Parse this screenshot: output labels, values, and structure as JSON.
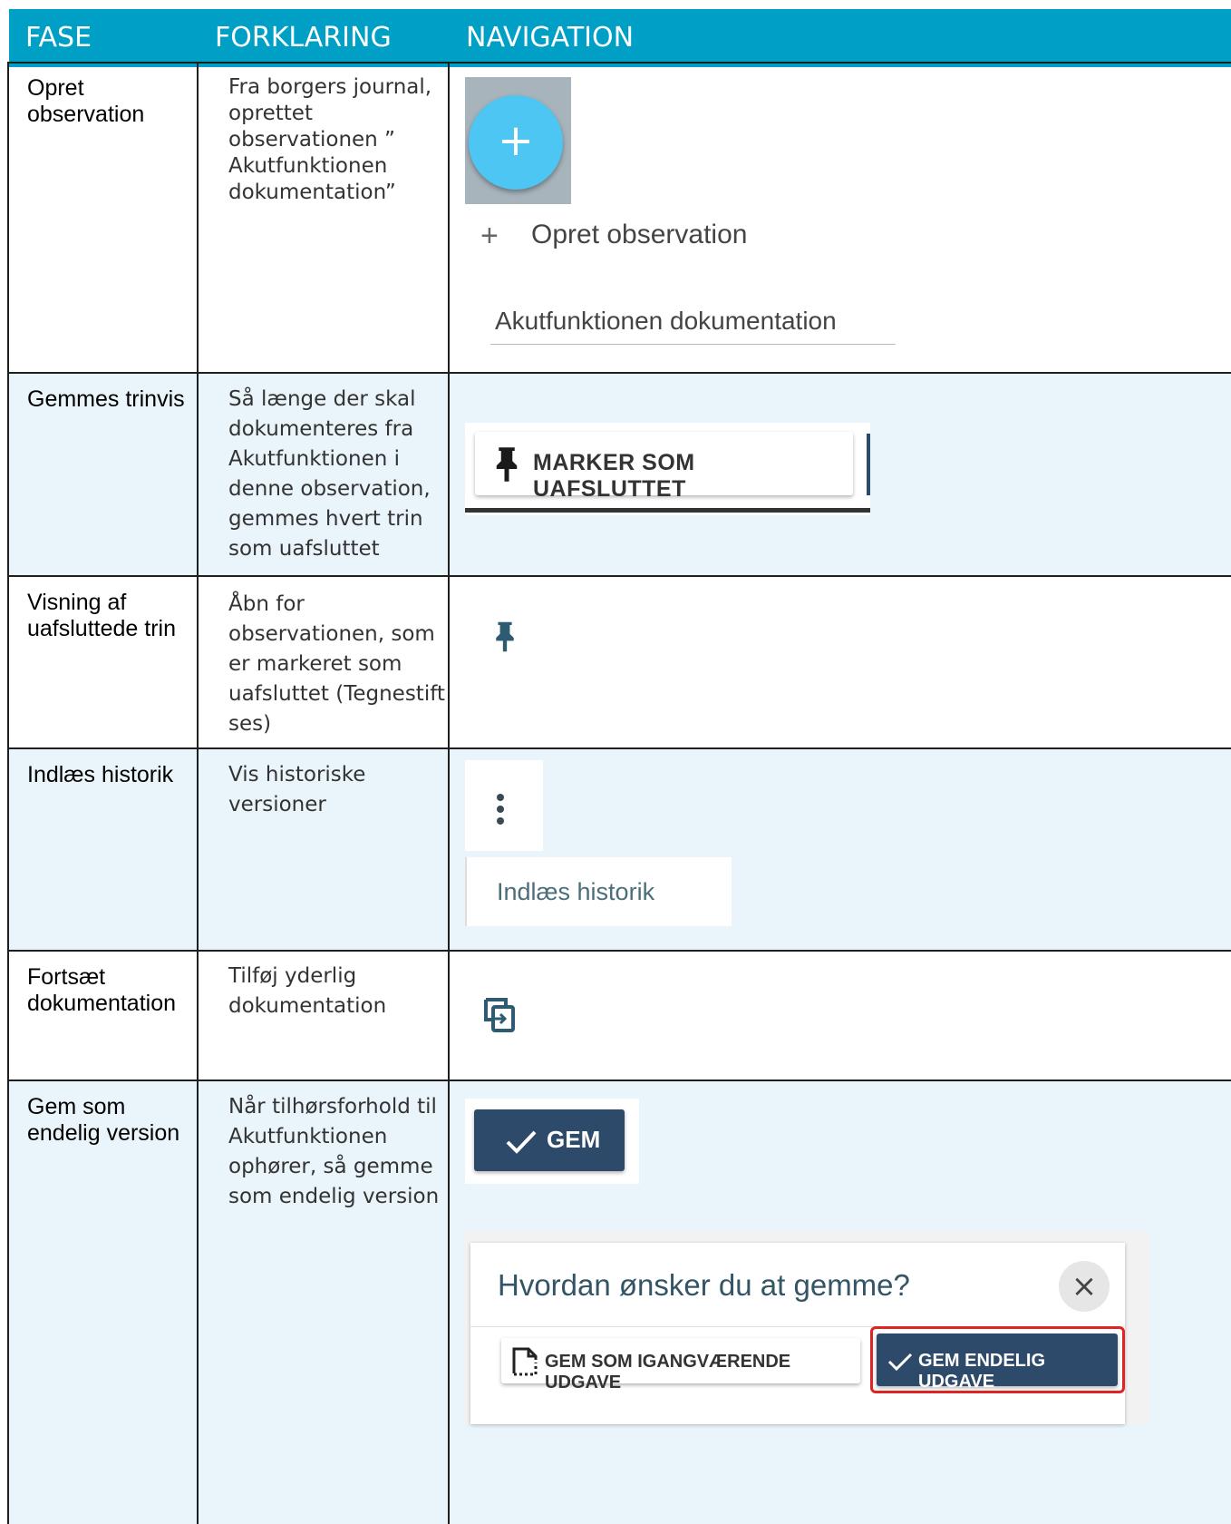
{
  "header": {
    "col1": "FASE",
    "col2": "FORKLARING",
    "col3": "NAVIGATION"
  },
  "colors": {
    "header_bg": "#00a0c6",
    "row_tint": "#eaf4fb",
    "primary_button": "#2e4a6b",
    "fab": "#4dc6f4",
    "highlight_border": "#e02424"
  },
  "rows": [
    {
      "fase": "Opret observation",
      "forklaring": "Fra borgers journal, oprettet observationen ” Akutfunktionen dokumentation”",
      "nav": {
        "fab_icon": "plus-icon",
        "fab_symbol": "+",
        "menu_symbol": "+",
        "menu_item": "Opret observation",
        "template_value": "Akutfunktionen dokumentation"
      }
    },
    {
      "fase": "Gemmes trinvis",
      "forklaring": "Så længe der skal dokumenteres fra Akutfunktionen i denne observation, gemmes hvert trin som uafsluttet",
      "nav": {
        "button_icon": "pin-icon",
        "button_label": "MARKER SOM UAFSLUTTET"
      }
    },
    {
      "fase": "Visning af uafsluttede trin",
      "forklaring": "Åbn for observationen, som er markeret som uafsluttet (Tegnestift ses)",
      "nav": {
        "icon": "pin-icon"
      }
    },
    {
      "fase": "Indlæs historik",
      "forklaring": "Vis historiske versioner",
      "nav": {
        "icon": "more-vert-icon",
        "menu_item": "Indlæs historik"
      }
    },
    {
      "fase": "Fortsæt dokumentation",
      "forklaring": "Tilføj yderlig dokumentation",
      "nav": {
        "icon": "continue-icon"
      }
    },
    {
      "fase": "Gem som endelig version",
      "forklaring": "Når tilhørsforhold til Akutfunktionen ophører, så gemme som endelig version",
      "nav": {
        "gem_label": "GEM",
        "dialog_title": "Hvordan ønsker du at gemme?",
        "close_symbol": "×",
        "draft_label": "GEM SOM IGANGVÆRENDE UDGAVE",
        "final_label": "GEM ENDELIG UDGAVE"
      }
    }
  ]
}
